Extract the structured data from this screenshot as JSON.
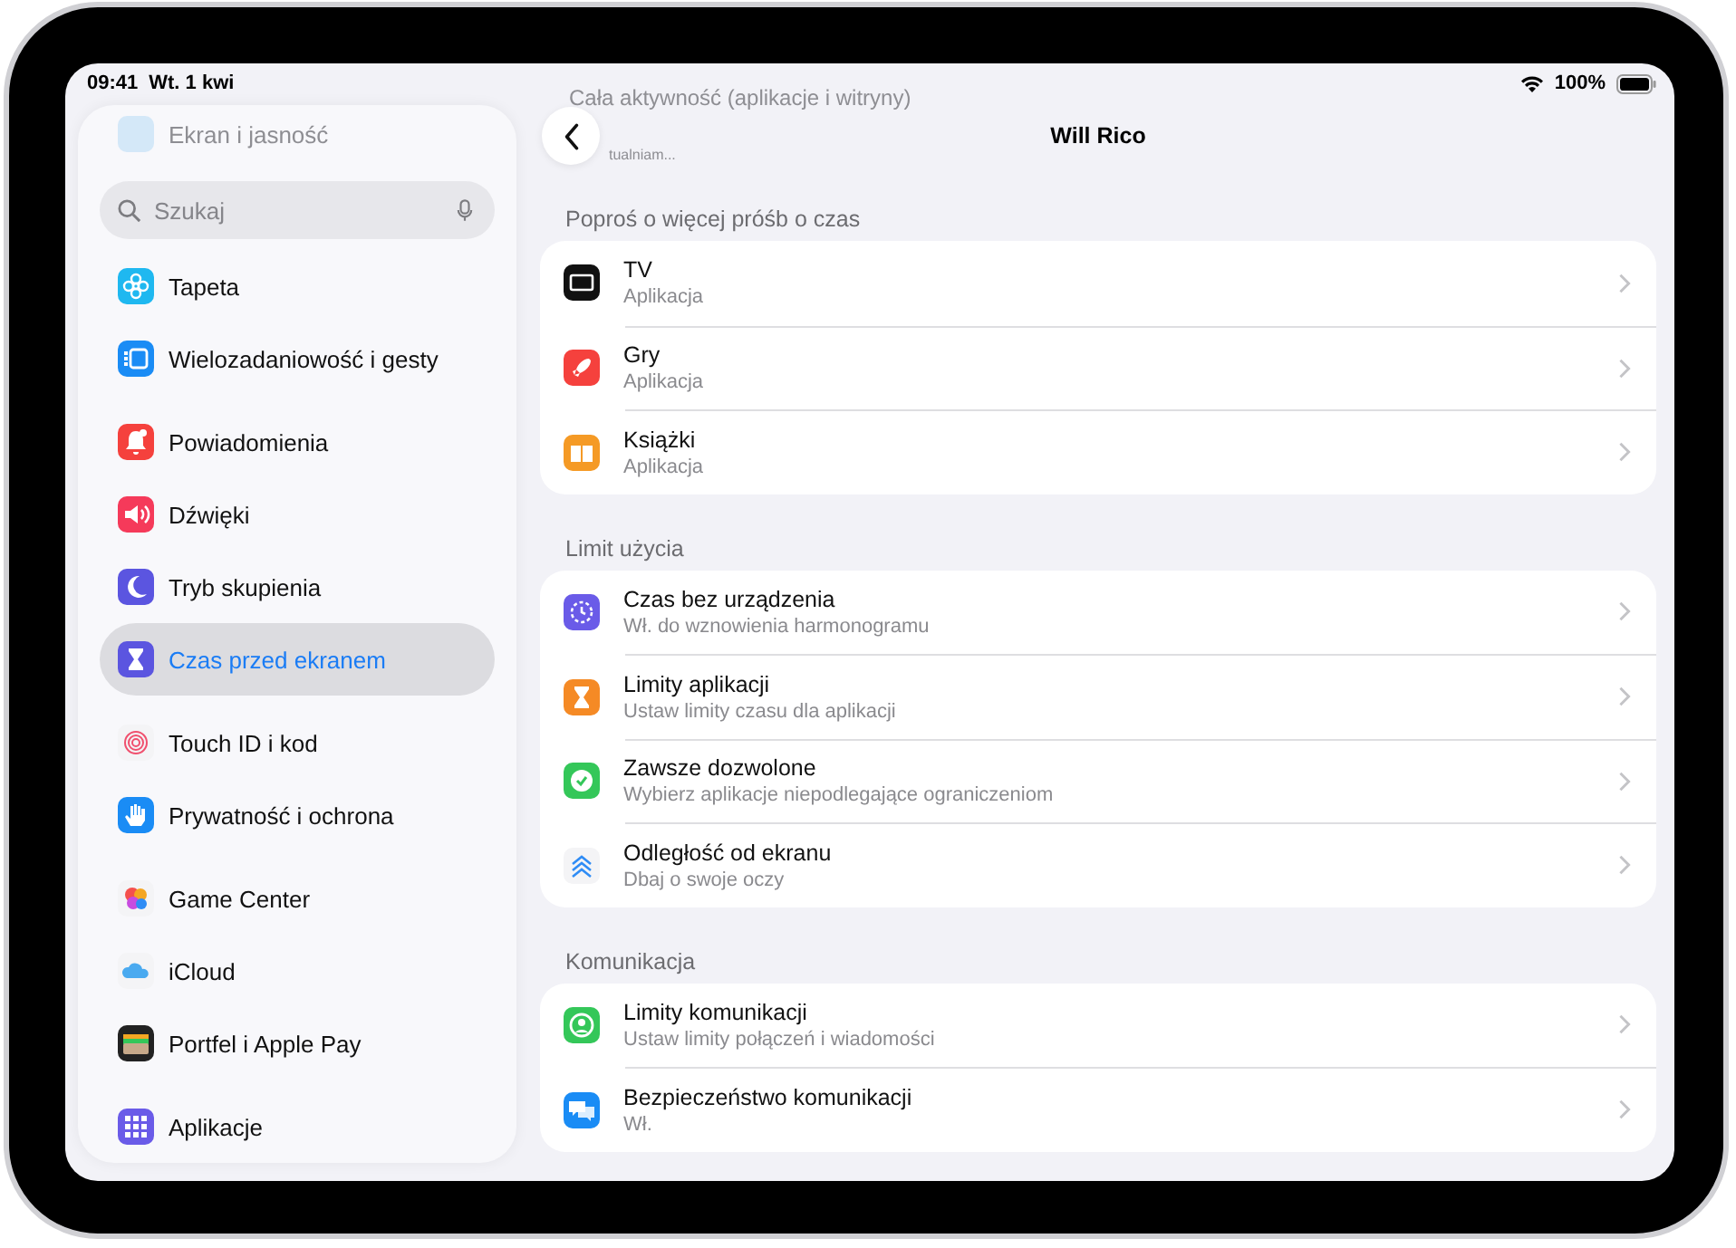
{
  "status_bar": {
    "time": "09:41",
    "date": "Wt. 1 kwi",
    "battery": "100%"
  },
  "sidebar": {
    "faded_item": {
      "label": "Ekran i jasność"
    },
    "search": {
      "placeholder": "Szukaj"
    },
    "groups": [
      {
        "items": [
          {
            "label": "Tapeta",
            "selected": false
          },
          {
            "label": "Wielozadaniowość i gesty",
            "selected": false
          }
        ]
      },
      {
        "items": [
          {
            "label": "Powiadomienia",
            "selected": false
          },
          {
            "label": "Dźwięki",
            "selected": false
          },
          {
            "label": "Tryb skupienia",
            "selected": false
          },
          {
            "label": "Czas przed ekranem",
            "selected": true
          }
        ]
      },
      {
        "items": [
          {
            "label": "Touch ID i kod",
            "selected": false
          },
          {
            "label": "Prywatność i ochrona",
            "selected": false
          }
        ]
      },
      {
        "items": [
          {
            "label": "Game Center",
            "selected": false
          },
          {
            "label": "iCloud",
            "selected": false
          },
          {
            "label": "Portfel i Apple Pay",
            "selected": false
          }
        ]
      },
      {
        "items": [
          {
            "label": "Aplikacje",
            "selected": false
          }
        ]
      }
    ]
  },
  "detail": {
    "faded_header": "Cała aktywność (aplikacje i witryny)",
    "faded_status": "tualniam...",
    "title": "Will Rico",
    "sections": [
      {
        "header": "Poproś o więcej próśb o czas",
        "rows": [
          {
            "title": "TV",
            "subtitle": "Aplikacja"
          },
          {
            "title": "Gry",
            "subtitle": "Aplikacja"
          },
          {
            "title": "Książki",
            "subtitle": "Aplikacja"
          }
        ]
      },
      {
        "header": "Limit użycia",
        "rows": [
          {
            "title": "Czas bez urządzenia",
            "subtitle": "Wł. do wznowienia harmonogramu"
          },
          {
            "title": "Limity aplikacji",
            "subtitle": "Ustaw limity czasu dla aplikacji"
          },
          {
            "title": "Zawsze dozwolone",
            "subtitle": "Wybierz aplikacje niepodlegające ograniczeniom"
          },
          {
            "title": "Odległość od ekranu",
            "subtitle": "Dbaj o swoje oczy"
          }
        ]
      },
      {
        "header": "Komunikacja",
        "rows": [
          {
            "title": "Limity komunikacji",
            "subtitle": "Ustaw limity połączeń i wiadomości"
          },
          {
            "title": "Bezpieczeństwo komunikacji",
            "subtitle": "Wł."
          }
        ]
      }
    ]
  }
}
